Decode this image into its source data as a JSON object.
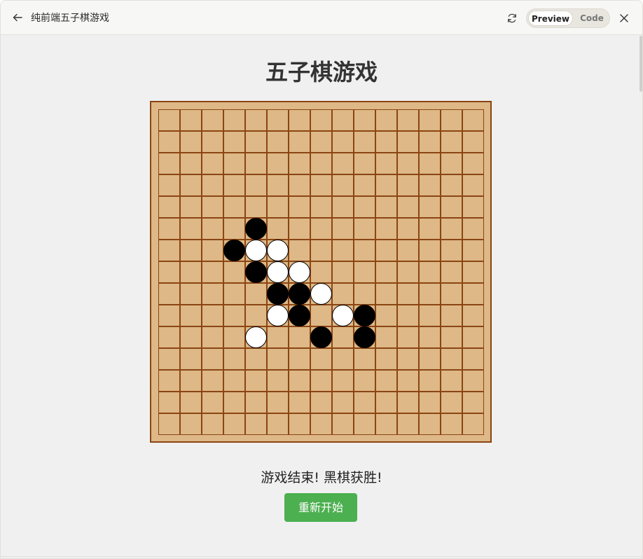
{
  "window": {
    "title": "纯前端五子棋游戏",
    "preview_label": "Preview",
    "code_label": "Code"
  },
  "icons": {
    "back": "arrow-left-icon",
    "refresh": "refresh-icon",
    "close": "close-icon"
  },
  "game": {
    "title": "五子棋游戏",
    "status": "游戏结束! 黑棋获胜!",
    "restart_label": "重新开始",
    "board_size": 15,
    "stones": [
      {
        "row": 5,
        "col": 4,
        "color": "black"
      },
      {
        "row": 6,
        "col": 3,
        "color": "black"
      },
      {
        "row": 6,
        "col": 4,
        "color": "white"
      },
      {
        "row": 6,
        "col": 5,
        "color": "white"
      },
      {
        "row": 7,
        "col": 4,
        "color": "black"
      },
      {
        "row": 7,
        "col": 5,
        "color": "white"
      },
      {
        "row": 7,
        "col": 6,
        "color": "white"
      },
      {
        "row": 8,
        "col": 5,
        "color": "black"
      },
      {
        "row": 8,
        "col": 6,
        "color": "black"
      },
      {
        "row": 8,
        "col": 7,
        "color": "white"
      },
      {
        "row": 9,
        "col": 5,
        "color": "white"
      },
      {
        "row": 9,
        "col": 6,
        "color": "black"
      },
      {
        "row": 9,
        "col": 8,
        "color": "white"
      },
      {
        "row": 9,
        "col": 9,
        "color": "black"
      },
      {
        "row": 10,
        "col": 4,
        "color": "white"
      },
      {
        "row": 10,
        "col": 7,
        "color": "black"
      },
      {
        "row": 10,
        "col": 9,
        "color": "black"
      }
    ]
  },
  "colors": {
    "board": "#deb887",
    "grid_line": "#8b4513",
    "button": "#4caf50"
  }
}
